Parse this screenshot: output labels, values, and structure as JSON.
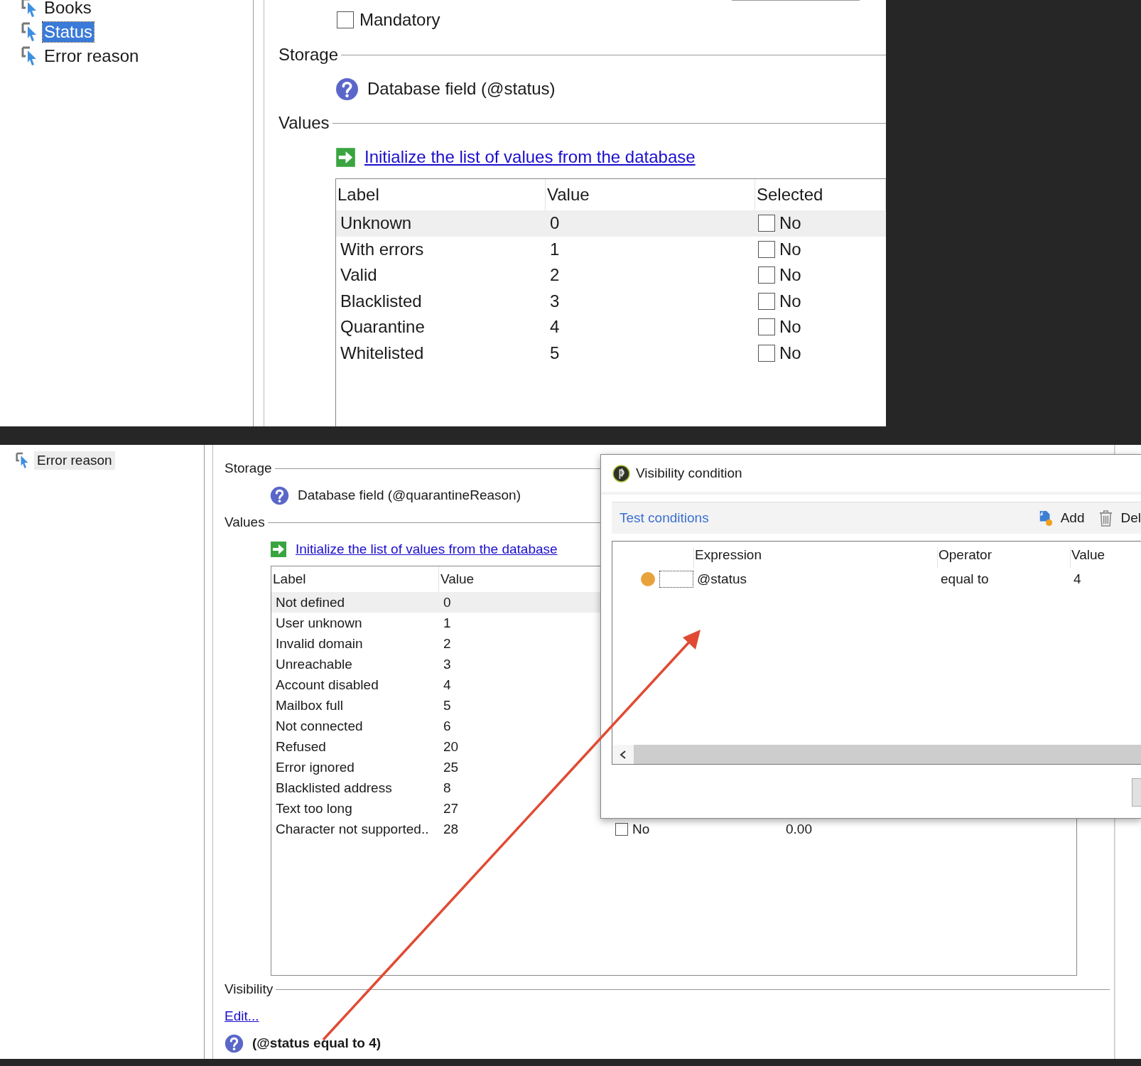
{
  "top_panel": {
    "tree": [
      {
        "label": "Books",
        "selected": false
      },
      {
        "label": "Status",
        "selected": true
      },
      {
        "label": "Error reason",
        "selected": false
      }
    ],
    "mandatory": {
      "label": "Mandatory",
      "checked": false
    },
    "storage": {
      "heading": "Storage",
      "text": "Database field (@status)"
    },
    "values": {
      "heading": "Values",
      "link": "Initialize the list of values from the database",
      "columns": [
        "Label",
        "Value",
        "Selected"
      ],
      "rows": [
        {
          "label": "Unknown",
          "value": "0",
          "checked": false,
          "check_label": "No",
          "selected": true
        },
        {
          "label": "With errors",
          "value": "1",
          "checked": false,
          "check_label": "No",
          "selected": false
        },
        {
          "label": "Valid",
          "value": "2",
          "checked": false,
          "check_label": "No",
          "selected": false
        },
        {
          "label": "Blacklisted",
          "value": "3",
          "checked": false,
          "check_label": "No",
          "selected": false
        },
        {
          "label": "Quarantine",
          "value": "4",
          "checked": false,
          "check_label": "No",
          "selected": false
        },
        {
          "label": "Whitelisted",
          "value": "5",
          "checked": false,
          "check_label": "No",
          "selected": false
        }
      ]
    }
  },
  "bottom_panel": {
    "tree": [
      {
        "label": "Error reason",
        "selected": true
      }
    ],
    "storage": {
      "heading": "Storage",
      "text": "Database field (@quarantineReason)"
    },
    "values": {
      "heading": "Values",
      "link": "Initialize the list of values from the database",
      "columns": [
        "Label",
        "Value"
      ],
      "rows": [
        {
          "label": "Not defined",
          "value": "0",
          "selected": true
        },
        {
          "label": "User unknown",
          "value": "1",
          "selected": false
        },
        {
          "label": "Invalid domain",
          "value": "2",
          "selected": false
        },
        {
          "label": "Unreachable",
          "value": "3",
          "selected": false
        },
        {
          "label": "Account disabled",
          "value": "4",
          "selected": false
        },
        {
          "label": "Mailbox full",
          "value": "5",
          "selected": false
        },
        {
          "label": "Not connected",
          "value": "6",
          "selected": false
        },
        {
          "label": "Refused",
          "value": "20",
          "selected": false
        },
        {
          "label": "Error ignored",
          "value": "25",
          "selected": false
        },
        {
          "label": "Blacklisted address",
          "value": "8",
          "selected": false
        },
        {
          "label": "Text too long",
          "value": "27",
          "selected": false
        },
        {
          "label": "Character not supported..",
          "value": "28",
          "selected": false,
          "checked": false,
          "check_label": "No",
          "amount": "0.00"
        }
      ]
    },
    "visibility": {
      "heading": "Visibility",
      "link": "Edit...",
      "condition": "(@status equal to 4)"
    }
  },
  "dialog": {
    "title": "Visibility condition",
    "toolbar": {
      "title": "Test conditions",
      "add": "Add",
      "delete": "Del"
    },
    "columns": [
      "Expression",
      "Operator",
      "Value"
    ],
    "rows": [
      {
        "color": "#e8a23c",
        "expression": "@status",
        "operator": "equal to",
        "value": "4"
      }
    ]
  }
}
